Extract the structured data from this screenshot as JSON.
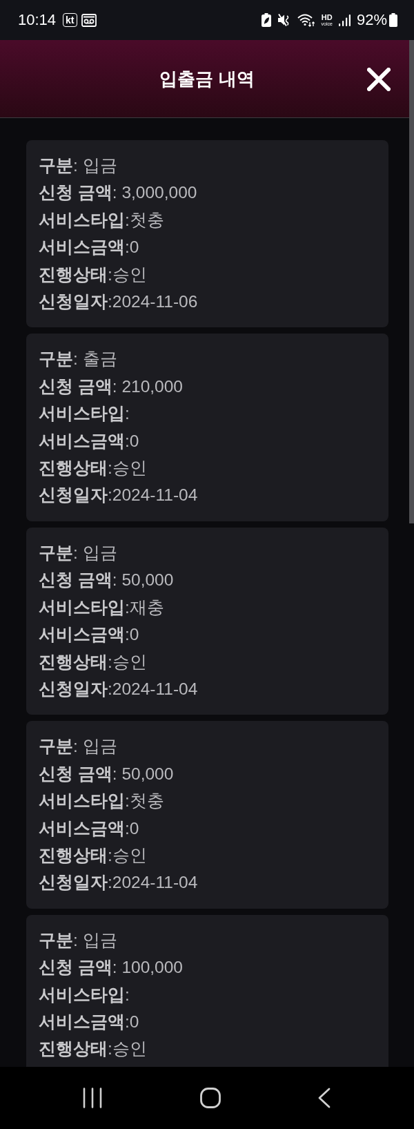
{
  "status_bar": {
    "time": "10:14",
    "carrier": "kt",
    "hd": "HD",
    "hd_sub": "voice",
    "battery_percent": "92%"
  },
  "header": {
    "title": "입출금 내역"
  },
  "records": [
    {
      "lines": [
        "**구분**: 입금",
        "**신청 금액**: 3,000,000",
        "**서비스타입**:첫충",
        "**서비스금액**:0",
        "**진행상태**:승인",
        "**신청일자**:2024-11-06"
      ]
    },
    {
      "lines": [
        "**구분**: 출금",
        "**신청 금액**: 210,000",
        "**서비스타입**:",
        "**서비스금액**:0",
        "**진행상태**:승인",
        "**신청일자**:2024-11-04"
      ]
    },
    {
      "lines": [
        "**구분**: 입금",
        "**신청 금액**: 50,000",
        "**서비스타입**:재충",
        "**서비스금액**:0",
        "**진행상태**:승인",
        "**신청일자**:2024-11-04"
      ]
    },
    {
      "lines": [
        "**구분**: 입금",
        "**신청 금액**: 50,000",
        "**서비스타입**:첫충",
        "**서비스금액**:0",
        "**진행상태**:승인",
        "**신청일자**:2024-11-04"
      ]
    },
    {
      "lines": [
        "**구분**: 입금",
        "**신청 금액**: 100,000",
        "**서비스타입**:",
        "**서비스금액**:0",
        "**진행상태**:승인"
      ]
    }
  ]
}
